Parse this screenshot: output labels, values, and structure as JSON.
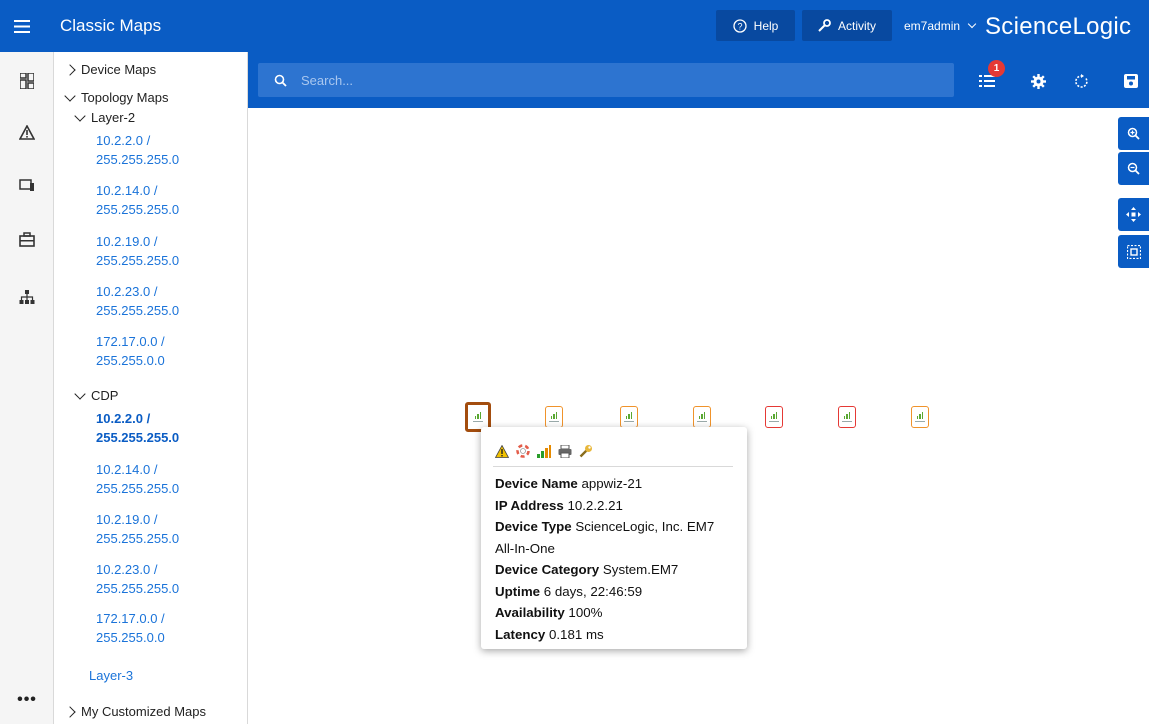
{
  "app": {
    "title": "Classic Maps",
    "help_label": "Help",
    "activity_label": "Activity",
    "user_label": "em7admin",
    "brand": "ScienceLogic"
  },
  "search": {
    "placeholder": "Search..."
  },
  "toolbar": {
    "notification_count": "1"
  },
  "tree": {
    "device_maps": "Device Maps",
    "topology_maps": "Topology Maps",
    "layer2": {
      "label": "Layer-2",
      "items": [
        {
          "line1": "10.2.2.0 /",
          "line2": "255.255.255.0"
        },
        {
          "line1": "10.2.14.0 /",
          "line2": "255.255.255.0"
        },
        {
          "line1": "10.2.19.0 /",
          "line2": "255.255.255.0"
        },
        {
          "line1": "10.2.23.0 /",
          "line2": "255.255.255.0"
        },
        {
          "line1": "172.17.0.0 /",
          "line2": "255.255.0.0"
        }
      ]
    },
    "cdp": {
      "label": "CDP",
      "items": [
        {
          "line1": "10.2.2.0 /",
          "line2": "255.255.255.0",
          "active": true
        },
        {
          "line1": "10.2.14.0 /",
          "line2": "255.255.255.0"
        },
        {
          "line1": "10.2.19.0 /",
          "line2": "255.255.255.0"
        },
        {
          "line1": "10.2.23.0 /",
          "line2": "255.255.255.0"
        },
        {
          "line1": "172.17.0.0 /",
          "line2": "255.255.0.0"
        }
      ]
    },
    "layer3": "Layer-3",
    "customized": "My Customized Maps"
  },
  "tooltip": {
    "device_name_label": "Device Name",
    "device_name": "appwiz-21",
    "ip_label": "IP Address",
    "ip": "10.2.2.21",
    "type_label": "Device Type",
    "type_line1": "ScienceLogic, Inc. EM7",
    "type_line2": "All-In-One",
    "category_label": "Device Category",
    "category": "System.EM7",
    "uptime_label": "Uptime",
    "uptime": "6 days, 22:46:59",
    "availability_label": "Availability",
    "availability": "100%",
    "latency_label": "Latency",
    "latency": "0.181 ms"
  },
  "colors": {
    "primary": "#0a5cc4",
    "link": "#1a73d9",
    "node_warning": "#f0932b",
    "node_critical": "#e53935",
    "node_selected": "#a34d0e"
  }
}
